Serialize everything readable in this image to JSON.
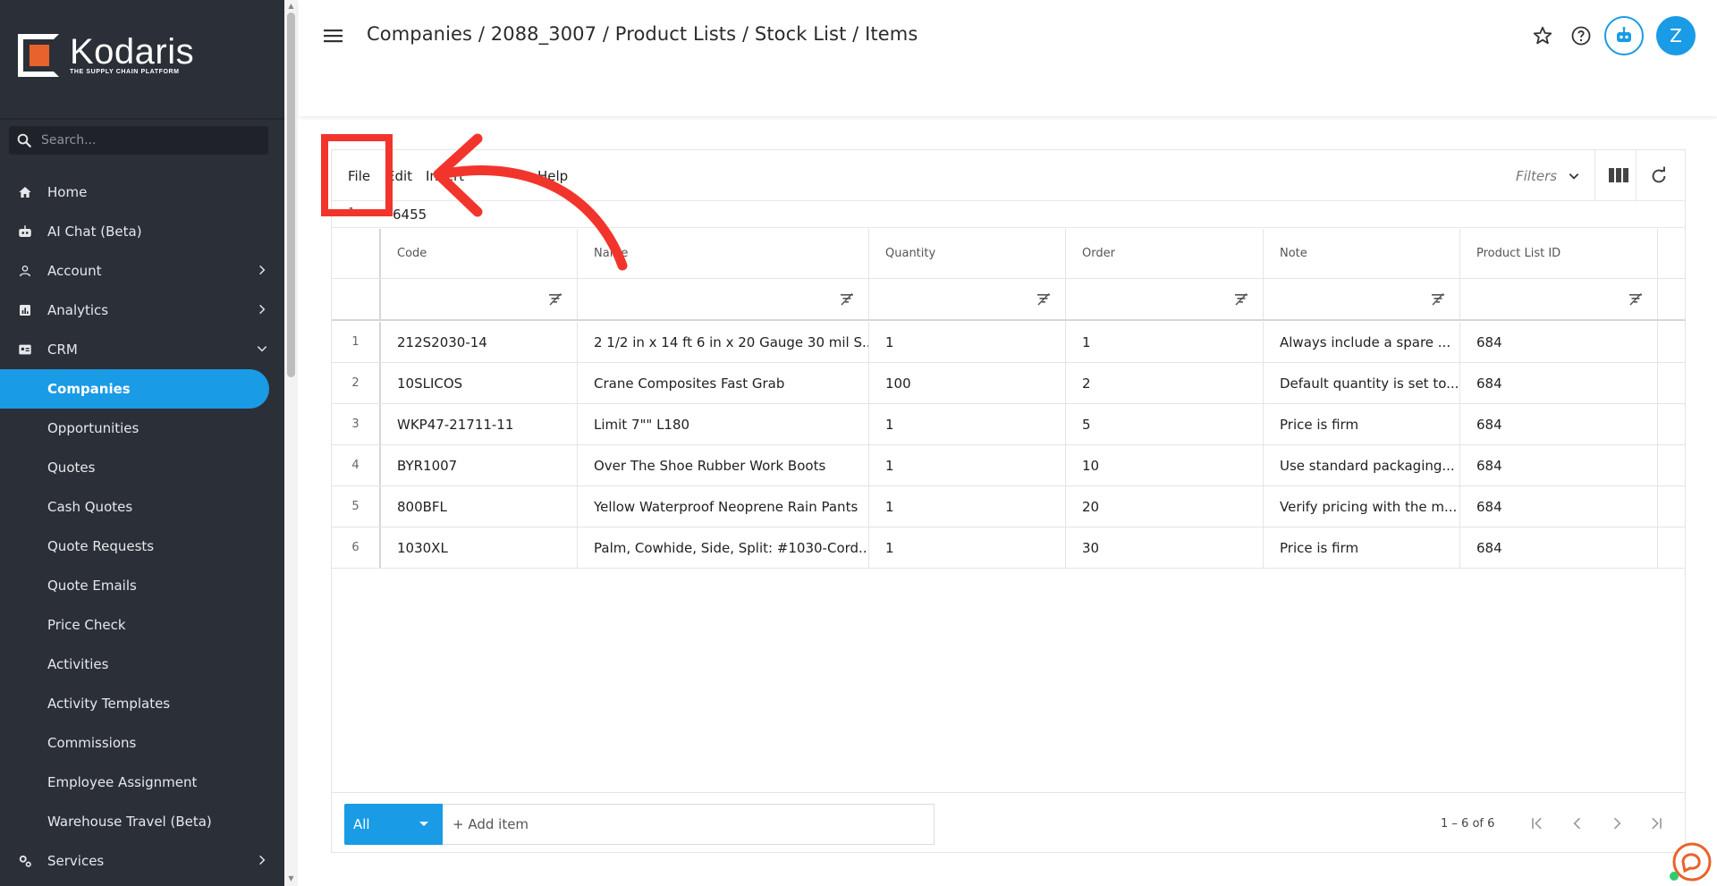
{
  "app": {
    "name": "Kodaris",
    "tagline": "THE SUPPLY CHAIN PLATFORM"
  },
  "sidebar": {
    "search_placeholder": "Search...",
    "items": [
      {
        "label": "Home",
        "icon": "home-icon",
        "has_chevron": false
      },
      {
        "label": "AI Chat (Beta)",
        "icon": "robot-icon",
        "has_chevron": false
      },
      {
        "label": "Account",
        "icon": "person-icon",
        "has_chevron": true
      },
      {
        "label": "Analytics",
        "icon": "analytics-icon",
        "has_chevron": true
      },
      {
        "label": "CRM",
        "icon": "crm-icon",
        "has_chevron": true,
        "expanded": true
      }
    ],
    "crm_items": [
      "Companies",
      "Opportunities",
      "Quotes",
      "Cash Quotes",
      "Quote Requests",
      "Quote Emails",
      "Price Check",
      "Activities",
      "Activity Templates",
      "Commissions",
      "Employee Assignment",
      "Warehouse Travel (Beta)"
    ],
    "active_item": "Companies",
    "bottom_item": {
      "label": "Services",
      "icon": "services-icon",
      "has_chevron": true
    }
  },
  "header": {
    "breadcrumb": "Companies / 2088_3007 / Product Lists / Stock List / Items",
    "avatar_initial": "Z"
  },
  "toolbar": {
    "menu": [
      "File",
      "Edit",
      "Insert",
      "Help"
    ],
    "filters_label": "Filters"
  },
  "formula_bar": {
    "row": "1",
    "value": "6455"
  },
  "table": {
    "columns": [
      "Code",
      "Name",
      "Quantity",
      "Order",
      "Note",
      "Product List ID"
    ],
    "rows": [
      {
        "num": "1",
        "code": "212S2030-14",
        "name": "2 1/2 in x 14 ft 6 in x 20 Gauge 30 mil S...",
        "quantity": "1",
        "order": "1",
        "note": "Always include a spare ...",
        "product_list_id": "684"
      },
      {
        "num": "2",
        "code": "10SLICOS",
        "name": "Crane Composites Fast Grab",
        "quantity": "100",
        "order": "2",
        "note": "Default quantity is set to...",
        "product_list_id": "684"
      },
      {
        "num": "3",
        "code": "WKP47-21711-11",
        "name": "Limit 7\"\" L180",
        "quantity": "1",
        "order": "5",
        "note": "Price is firm",
        "product_list_id": "684"
      },
      {
        "num": "4",
        "code": "BYR1007",
        "name": "Over The Shoe Rubber Work Boots",
        "quantity": "1",
        "order": "10",
        "note": "Use standard packaging...",
        "product_list_id": "684"
      },
      {
        "num": "5",
        "code": "800BFL",
        "name": "Yellow Waterproof Neoprene Rain Pants",
        "quantity": "1",
        "order": "20",
        "note": "Verify pricing with the m...",
        "product_list_id": "684"
      },
      {
        "num": "6",
        "code": "1030XL",
        "name": "Palm, Cowhide, Side, Split: #1030-Cord...",
        "quantity": "1",
        "order": "30",
        "note": "Price is firm",
        "product_list_id": "684"
      }
    ]
  },
  "footer": {
    "view_select": "All",
    "add_item_label": "+ Add item",
    "page_info": "1 – 6 of 6"
  },
  "colors": {
    "accent": "#1a9be6",
    "sidebar_bg": "#2b3038",
    "annotation": "#f2352c",
    "brand_orange": "#e8632b"
  }
}
